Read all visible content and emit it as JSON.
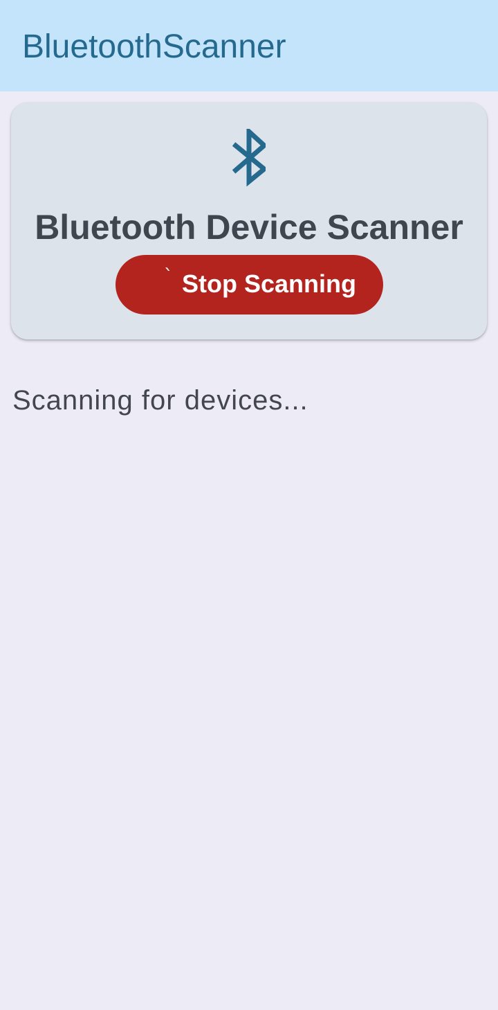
{
  "app_bar": {
    "title": "BluetoothScanner"
  },
  "scanner_card": {
    "icon": "bluetooth-icon",
    "title": "Bluetooth Device Scanner",
    "button": {
      "spinner_glyph": "`",
      "label": "Stop Scanning"
    }
  },
  "status": {
    "text": "Scanning for devices..."
  },
  "colors": {
    "app_bar_bg": "#c4e4fc",
    "app_title": "#256a8e",
    "background": "#edebf6",
    "card_bg": "#dde3eb",
    "icon": "#256a8e",
    "stop_button_bg": "#b3241e",
    "text_primary": "#40464f"
  }
}
